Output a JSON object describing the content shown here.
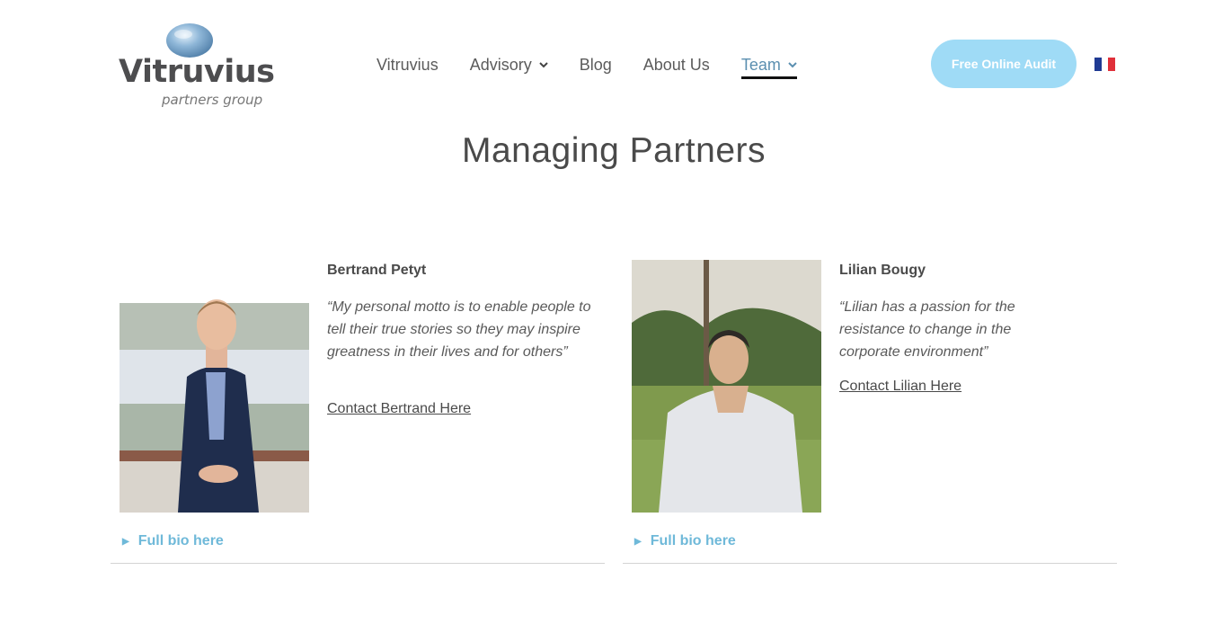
{
  "brand": {
    "name": "Vitruvius",
    "tagline": "partners group"
  },
  "nav": {
    "items": [
      {
        "label": "Vitruvius"
      },
      {
        "label": "Advisory",
        "has_dropdown": true
      },
      {
        "label": "Blog"
      },
      {
        "label": "About Us"
      },
      {
        "label": "Team",
        "has_dropdown": true,
        "active": true
      }
    ]
  },
  "cta": {
    "label": "Free Online Audit"
  },
  "language": {
    "icon": "french-flag-icon"
  },
  "page": {
    "title": "Managing Partners"
  },
  "partners": [
    {
      "name": "Bertrand Petyt",
      "quote": "“My personal motto is to enable people to tell their true stories so they may inspire greatness in their lives and for others”",
      "contact_label": "Contact Bertrand Here",
      "bio_label": "Full bio here"
    },
    {
      "name": "Lilian Bougy",
      "quote": "“Lilian has a passion for the resistance to change in the corporate environment”",
      "contact_label": "Contact Lilian Here",
      "bio_label": "Full bio here"
    }
  ],
  "colors": {
    "accent": "#6fb9d9",
    "cta_bg": "#9fdbf6",
    "active_nav": "#5b8fb0",
    "text": "#4a4a4a"
  }
}
